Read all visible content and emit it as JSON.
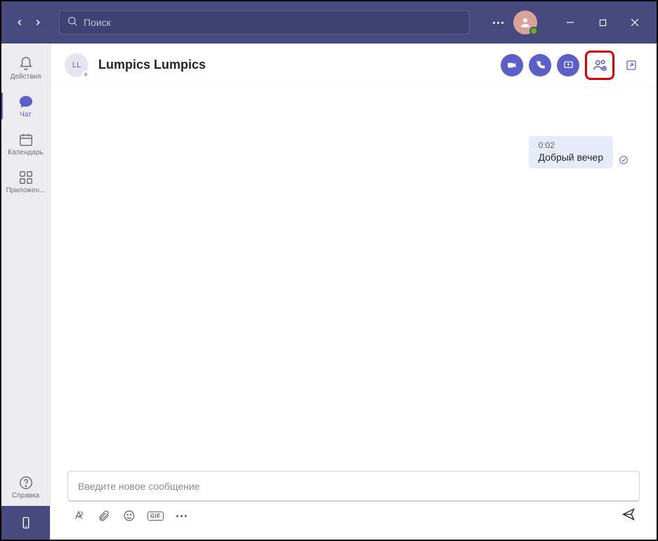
{
  "search": {
    "placeholder": "Поиск"
  },
  "rail": {
    "activity": "Действия",
    "chat": "Чат",
    "calendar": "Календарь",
    "apps": "Приложен...",
    "help": "Справка"
  },
  "chat": {
    "avatar_initials": "LL",
    "title": "Lumpics Lumpics"
  },
  "message": {
    "time": "0:02",
    "text": "Добрый вечер"
  },
  "composer": {
    "placeholder": "Введите новое сообщение",
    "gif": "GIF"
  }
}
